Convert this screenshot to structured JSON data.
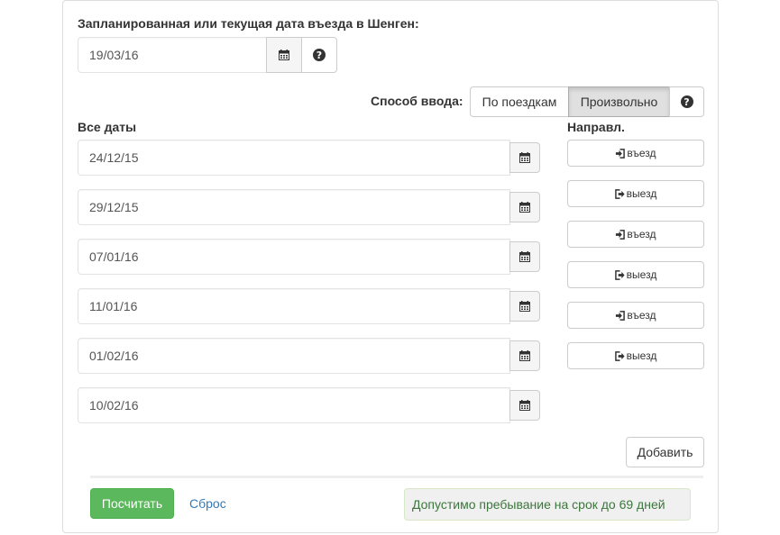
{
  "entry_label": "Запланированная или текущая дата въезда в Шенген:",
  "entry_date": "19/03/16",
  "input_method": {
    "label": "Способ ввода:",
    "options": [
      "По поездкам",
      "Произвольно"
    ],
    "selected": "Произвольно"
  },
  "dates_header": "Все даты",
  "direction_header": "Направл.",
  "dates": [
    "24/12/15",
    "29/12/15",
    "07/01/16",
    "11/01/16",
    "01/02/16",
    "10/02/16"
  ],
  "directions": [
    "въезд",
    "выезд",
    "въезд",
    "выезд",
    "въезд",
    "выезд"
  ],
  "add_button": "Добавить",
  "calculate_button": "Посчитать",
  "reset_link": "Сброс",
  "result": "Допустимо пребывание на срок до 69 дней",
  "colors": {
    "success": "#5cb85c",
    "link": "#337ab7",
    "result_text": "#3c763d"
  },
  "icons": {
    "calendar": "calendar-icon",
    "help": "question-circle-icon",
    "entry": "sign-in-icon",
    "exit": "sign-out-icon"
  }
}
